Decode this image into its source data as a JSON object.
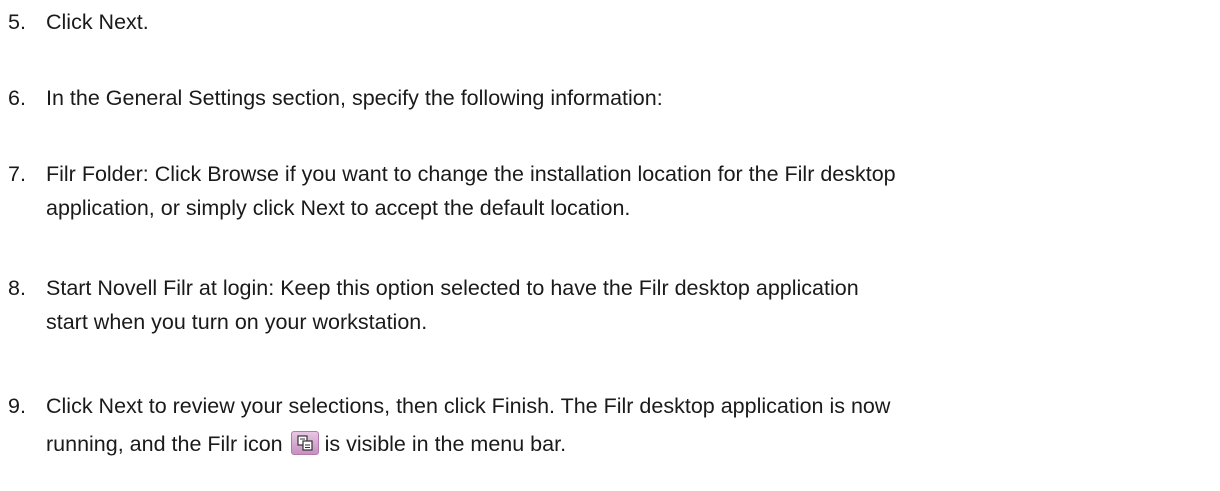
{
  "steps": [
    {
      "num": "5.",
      "text": "Click Next."
    },
    {
      "num": "6.",
      "text": "In the General Settings section, specify the following information:"
    },
    {
      "num": "7.",
      "line1": "Filr Folder: Click Browse if you want to change the installation location for the Filr desktop",
      "line2": "application, or simply click Next to accept the default location."
    },
    {
      "num": "8.",
      "line1": "Start Novell Filr at login: Keep this option selected to have the Filr desktop application",
      "line2": "start when you turn on your workstation."
    },
    {
      "num": "9.",
      "line1": "Click Next to review your selections, then click Finish.  The Filr desktop application is now",
      "line2_before_icon": "running, and the Filr icon",
      "line2_after_icon": "is visible in the menu bar.",
      "icon": "filr-icon"
    }
  ]
}
